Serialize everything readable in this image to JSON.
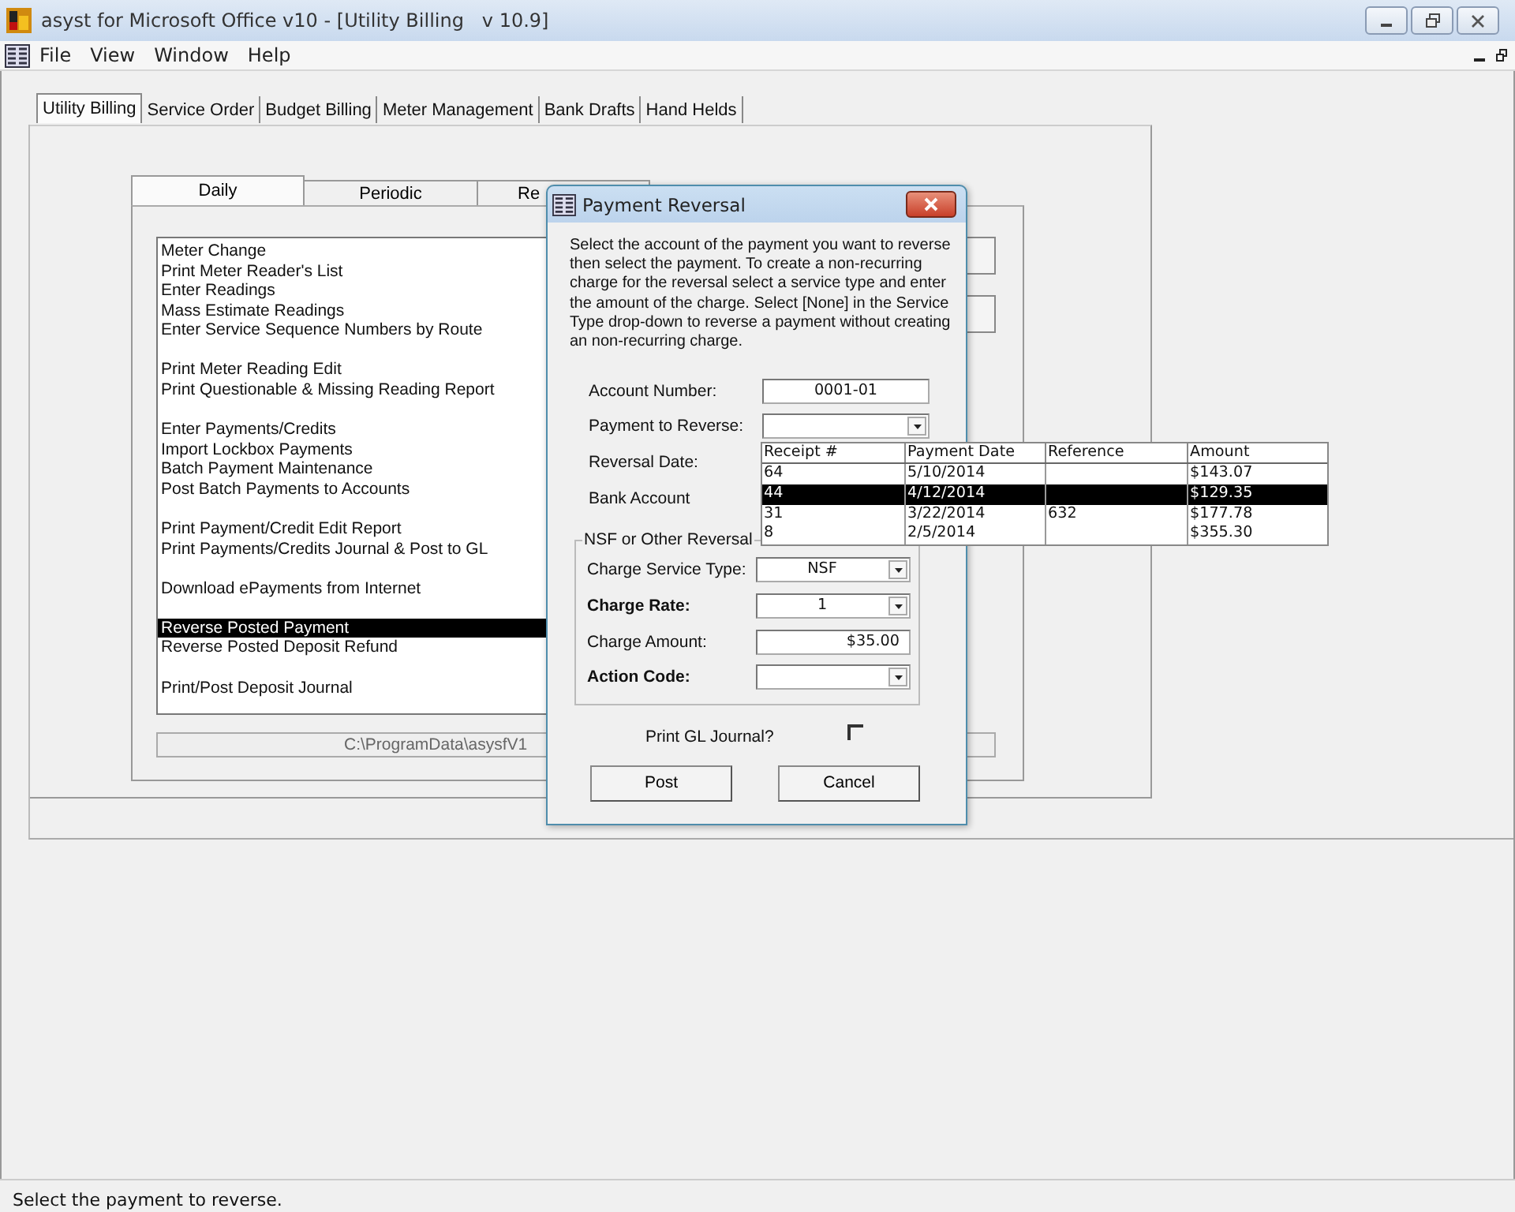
{
  "window": {
    "title": "asyst for Microsoft Office v10 - [Utility Billing   v 10.9]"
  },
  "menu": [
    "File",
    "View",
    "Window",
    "Help"
  ],
  "module_tabs": [
    {
      "label": "Utility Billing",
      "selected": true
    },
    {
      "label": "Service Order",
      "selected": false
    },
    {
      "label": "Budget Billing",
      "selected": false
    },
    {
      "label": "Meter Management",
      "selected": false
    },
    {
      "label": "Bank Drafts",
      "selected": false
    },
    {
      "label": "Hand Helds",
      "selected": false
    }
  ],
  "task_tabs": [
    {
      "label": "Daily",
      "selected": true
    },
    {
      "label": "Periodic",
      "selected": false
    },
    {
      "label": "Re",
      "selected": false
    }
  ],
  "task_groups": [
    [
      {
        "label": "Meter Change",
        "selected": false
      },
      {
        "label": "Print Meter Reader's List",
        "selected": false
      },
      {
        "label": "Enter Readings",
        "selected": false
      },
      {
        "label": "Mass Estimate Readings",
        "selected": false
      },
      {
        "label": "Enter Service Sequence Numbers by Route",
        "selected": false
      }
    ],
    [
      {
        "label": "Print Meter Reading Edit",
        "selected": false
      },
      {
        "label": "Print Questionable & Missing Reading Report",
        "selected": false
      }
    ],
    [
      {
        "label": "Enter Payments/Credits",
        "selected": false
      },
      {
        "label": "Import Lockbox Payments",
        "selected": false
      },
      {
        "label": "Batch Payment Maintenance",
        "selected": false
      },
      {
        "label": "Post Batch Payments to Accounts",
        "selected": false
      }
    ],
    [
      {
        "label": "Print Payment/Credit Edit Report",
        "selected": false
      },
      {
        "label": "Print Payments/Credits Journal & Post to GL",
        "selected": false
      }
    ],
    [
      {
        "label": "Download ePayments from Internet",
        "selected": false
      }
    ],
    [
      {
        "label": "Reverse Posted Payment",
        "selected": true
      },
      {
        "label": "Reverse Posted Deposit Refund",
        "selected": false
      }
    ],
    [
      {
        "label": "Print/Post Deposit Journal",
        "selected": false
      }
    ]
  ],
  "data_path": "C:\\ProgramData\\asysfV1",
  "dialog": {
    "title": "Payment Reversal",
    "instructions": "Select the account of the payment you want to reverse then select the payment.  To create a non-recurring charge for the reversal select a service type and enter the amount of the charge.  Select [None] in the Service Type drop-down to reverse a payment without creating an non-recurring charge.",
    "fields": [
      {
        "kind": "text",
        "label": "Account Number:",
        "value": "0001-01"
      },
      {
        "kind": "combo",
        "label": "Payment to Reverse:"
      },
      {
        "kind": "label",
        "label": "Reversal Date:"
      },
      {
        "kind": "label",
        "label": "Bank Account"
      }
    ],
    "group_title": "NSF or Other Reversal",
    "charge_fields": [
      {
        "kind": "combo",
        "label": "Charge Service Type:",
        "value": "NSF",
        "bold": false
      },
      {
        "kind": "combo",
        "label": "Charge Rate:",
        "value": "1",
        "bold": true
      },
      {
        "kind": "amount",
        "label": "Charge Amount:",
        "value": "$35.00",
        "bold": false
      },
      {
        "kind": "combo",
        "label": "Action Code:",
        "bold": true
      }
    ],
    "print_gl": {
      "label": "Print GL Journal?",
      "checked": false
    },
    "buttons": [
      "Post",
      "Cancel"
    ]
  },
  "payment_list": {
    "columns": [
      "Receipt #",
      "Payment Date",
      "Reference",
      "Amount"
    ],
    "rows": [
      {
        "cells": [
          "64",
          "5/10/2014",
          "",
          "$143.07"
        ],
        "selected": false
      },
      {
        "cells": [
          "44",
          "4/12/2014",
          "",
          "$129.35"
        ],
        "selected": true
      },
      {
        "cells": [
          "31",
          "3/22/2014",
          "632",
          "$177.78"
        ],
        "selected": false
      },
      {
        "cells": [
          "8",
          "2/5/2014",
          "",
          "$355.30"
        ],
        "selected": false
      }
    ]
  },
  "status_bar": "Select the payment to reverse."
}
